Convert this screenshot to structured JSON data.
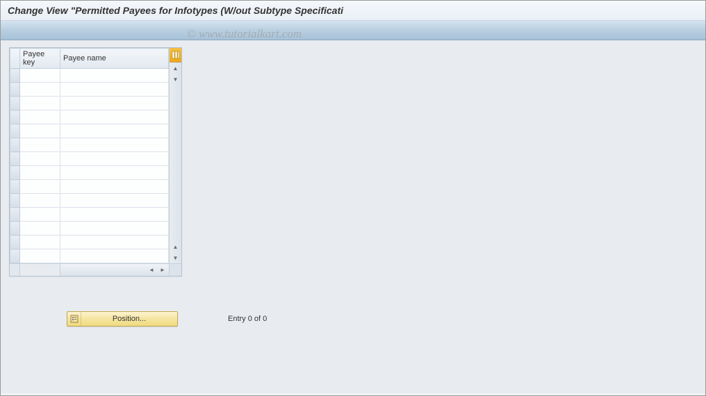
{
  "header": {
    "title": "Change View \"Permitted Payees for Infotypes (W/out Subtype Specificati"
  },
  "watermark": "© www.tutorialkart.com",
  "table": {
    "columns": {
      "payee_key": "Payee key",
      "payee_name": "Payee name"
    },
    "row_count": 14
  },
  "footer": {
    "position_button_label": "Position...",
    "entry_text": "Entry 0 of 0"
  },
  "icons": {
    "config": "config-columns-icon",
    "scroll_up": "▲",
    "scroll_down": "▼",
    "scroll_left": "◄",
    "scroll_right": "►"
  }
}
